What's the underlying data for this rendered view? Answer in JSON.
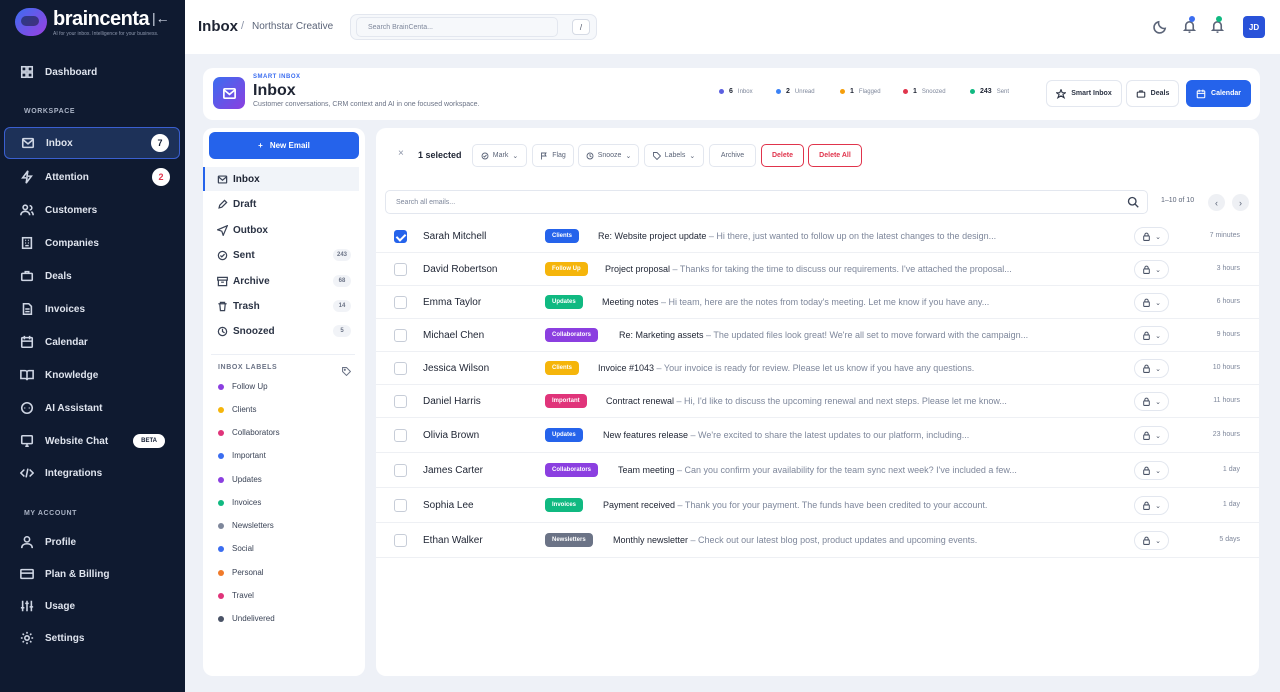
{
  "app": {
    "name": "braincenta",
    "tagline": "AI for your inbox. Intelligence for your business."
  },
  "sidebar": {
    "items": [
      {
        "label": "Dashboard",
        "icon": "dashboard-icon"
      },
      {
        "label": "Inbox",
        "icon": "inbox-icon",
        "count": "7"
      },
      {
        "label": "Attention",
        "icon": "bolt-icon",
        "count": "2"
      },
      {
        "label": "Customers",
        "icon": "users-icon"
      },
      {
        "label": "Companies",
        "icon": "building-icon"
      },
      {
        "label": "Deals",
        "icon": "briefcase-icon"
      },
      {
        "label": "Invoices",
        "icon": "invoice-icon"
      },
      {
        "label": "Calendar",
        "icon": "calendar-icon"
      },
      {
        "label": "Knowledge",
        "icon": "book-icon"
      },
      {
        "label": "AI Assistant",
        "icon": "chat-icon"
      },
      {
        "label": "Website Chat",
        "icon": "monitor-chat-icon",
        "badge": "BETA"
      },
      {
        "label": "Integrations",
        "icon": "code-icon"
      }
    ],
    "section_workspace": "WORKSPACE",
    "section_account": "MY ACCOUNT",
    "account_items": [
      {
        "label": "Profile",
        "icon": "user-icon"
      },
      {
        "label": "Plan & Billing",
        "icon": "card-icon"
      },
      {
        "label": "Usage",
        "icon": "sliders-icon"
      },
      {
        "label": "Settings",
        "icon": "gear-icon"
      }
    ]
  },
  "header": {
    "breadcrumb_main": "Inbox",
    "breadcrumb_sep": "/",
    "breadcrumb_workspace": "Northstar Creative",
    "search_placeholder": "Search BrainCenta...",
    "search_shortcut": "/",
    "avatar_initials": "JD",
    "notification_count": "1"
  },
  "page_header": {
    "overline": "SMART INBOX",
    "title": "Inbox",
    "subtitle": "Customer conversations, CRM context and AI in one focused workspace.",
    "stats": [
      {
        "value": "6",
        "label": "Inbox",
        "color": "#5b5fe0"
      },
      {
        "value": "2",
        "label": "Unread",
        "color": "#3b82f6"
      },
      {
        "value": "1",
        "label": "Flagged",
        "color": "#f59e0b"
      },
      {
        "value": "1",
        "label": "Snoozed",
        "color": "#e0344c"
      },
      {
        "value": "243",
        "label": "Sent",
        "color": "#10b981"
      }
    ],
    "buttons": {
      "smart_inbox": "Smart Inbox",
      "deals": "Deals",
      "calendar": "Calendar"
    }
  },
  "folders": {
    "new_email": "New Email",
    "items": [
      {
        "label": "Inbox",
        "icon": "inbox-icon",
        "count": ""
      },
      {
        "label": "Draft",
        "icon": "pencil-icon",
        "count": ""
      },
      {
        "label": "Outbox",
        "icon": "send-icon",
        "count": ""
      },
      {
        "label": "Sent",
        "icon": "check-circle-icon",
        "count": "243"
      },
      {
        "label": "Archive",
        "icon": "archive-icon",
        "count": "68"
      },
      {
        "label": "Trash",
        "icon": "trash-icon",
        "count": "14"
      },
      {
        "label": "Snoozed",
        "icon": "clock-icon",
        "count": "5"
      }
    ],
    "labels_header": "INBOX LABELS",
    "labels": [
      {
        "label": "Follow Up",
        "color": "#8b3fe0"
      },
      {
        "label": "Clients",
        "color": "#f5b50b"
      },
      {
        "label": "Collaborators",
        "color": "#e0347a"
      },
      {
        "label": "Important",
        "color": "#3b6df0"
      },
      {
        "label": "Updates",
        "color": "#8b3fe0"
      },
      {
        "label": "Invoices",
        "color": "#10b981"
      },
      {
        "label": "Newsletters",
        "color": "#7e879b"
      },
      {
        "label": "Social",
        "color": "#3b6df0"
      },
      {
        "label": "Personal",
        "color": "#f07a2a"
      },
      {
        "label": "Travel",
        "color": "#e0347a"
      },
      {
        "label": "Undelivered",
        "color": "#4a5366"
      }
    ]
  },
  "toolbar": {
    "selected": "1 selected",
    "mark": "Mark",
    "flag": "Flag",
    "snooze": "Snooze",
    "labels": "Labels",
    "archive": "Archive",
    "delete": "Delete",
    "delete_all": "Delete All"
  },
  "list": {
    "search_placeholder": "Search all emails...",
    "pagination": "1–10 of 10",
    "emails": [
      {
        "sender": "Sarah Mitchell",
        "tag": "Clients",
        "tag_color": "#2563eb",
        "subject": "Re: Website project update",
        "preview": " – Hi there, just wanted to follow up on the latest changes to the design...",
        "time": "7 minutes",
        "checked": true
      },
      {
        "sender": "David Robertson",
        "tag": "Follow Up",
        "tag_color": "#f5b50b",
        "subject": "Project proposal",
        "preview": " – Thanks for taking the time to discuss our requirements. I've attached the proposal...",
        "time": "3 hours",
        "checked": false
      },
      {
        "sender": "Emma Taylor",
        "tag": "Updates",
        "tag_color": "#10b981",
        "subject": "Meeting notes",
        "preview": " – Hi team, here are the notes from today's meeting. Let me know if you have any...",
        "time": "6 hours",
        "checked": false
      },
      {
        "sender": "Michael Chen",
        "tag": "Collaborators",
        "tag_color": "#8b3fe0",
        "subject": "Re: Marketing assets",
        "preview": " – The updated files look great! We're all set to move forward with the campaign...",
        "time": "9 hours",
        "checked": false
      },
      {
        "sender": "Jessica Wilson",
        "tag": "Clients",
        "tag_color": "#f5b50b",
        "subject": "Invoice #1043",
        "preview": " – Your invoice is ready for review. Please let us know if you have any questions.",
        "time": "10 hours",
        "checked": false
      },
      {
        "sender": "Daniel Harris",
        "tag": "Important",
        "tag_color": "#e0347a",
        "subject": "Contract renewal",
        "preview": " – Hi, I'd like to discuss the upcoming renewal and next steps. Please let me know...",
        "time": "11 hours",
        "checked": false
      },
      {
        "sender": "Olivia Brown",
        "tag": "Updates",
        "tag_color": "#2563eb",
        "subject": "New features release",
        "preview": " – We're excited to share the latest updates to our platform, including...",
        "time": "23 hours",
        "checked": false
      },
      {
        "sender": "James Carter",
        "tag": "Collaborators",
        "tag_color": "#8b3fe0",
        "subject": "Team meeting",
        "preview": " – Can you confirm your availability for the team sync next week? I've included a few...",
        "time": "1 day",
        "checked": false
      },
      {
        "sender": "Sophia Lee",
        "tag": "Invoices",
        "tag_color": "#10b981",
        "subject": "Payment received",
        "preview": " – Thank you for your payment. The funds have been credited to your account.",
        "time": "1 day",
        "checked": false
      },
      {
        "sender": "Ethan Walker",
        "tag": "Newsletters",
        "tag_color": "#6b7386",
        "subject": "Monthly newsletter",
        "preview": " – Check out our latest blog post, product updates and upcoming events.",
        "time": "5 days",
        "checked": false
      }
    ]
  }
}
